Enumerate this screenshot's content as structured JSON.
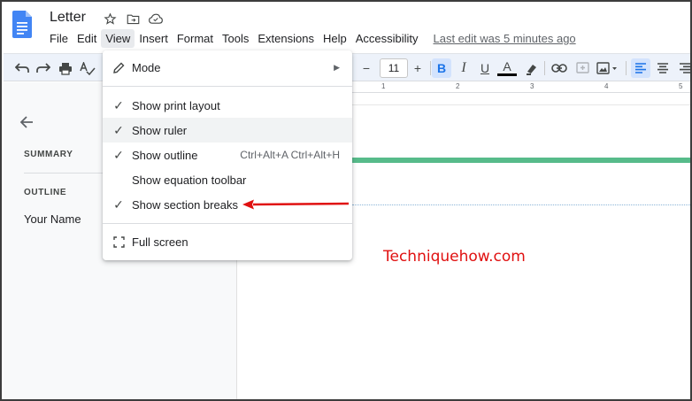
{
  "header": {
    "doc_title": "Letter",
    "menus": [
      "File",
      "Edit",
      "View",
      "Insert",
      "Format",
      "Tools",
      "Extensions",
      "Help",
      "Accessibility"
    ],
    "last_edit": "Last edit was 5 minutes ago"
  },
  "toolbar": {
    "font_size": "11",
    "decrease_label": "−",
    "increase_label": "+",
    "bold": "B",
    "italic": "I",
    "underline": "U",
    "text_color": "A"
  },
  "left_panel": {
    "summary": "SUMMARY",
    "outline": "OUTLINE",
    "heading": "Your Name"
  },
  "ruler": {
    "labels": [
      "1",
      "2",
      "3",
      "4",
      "5"
    ]
  },
  "view_menu": {
    "items": [
      {
        "label": "Mode",
        "icon": "pencil-icon",
        "checked": false
      },
      {
        "label": "Show print layout",
        "icon": "check-icon",
        "checked": true
      },
      {
        "label": "Show ruler",
        "icon": "check-icon",
        "checked": true
      },
      {
        "label": "Show outline",
        "icon": "check-icon",
        "checked": true,
        "shortcut": "Ctrl+Alt+A Ctrl+Alt+H"
      },
      {
        "label": "Show equation toolbar",
        "icon": "",
        "checked": false
      },
      {
        "label": "Show section breaks",
        "icon": "check-icon",
        "checked": true
      },
      {
        "label": "Full screen",
        "icon": "fullscreen-icon",
        "checked": false
      }
    ]
  },
  "watermark": "Techniquehow.com",
  "colors": {
    "accent": "#1a73e8",
    "green_bar": "#57bb8a",
    "arrow": "#e01010",
    "toolbar_bg": "#edf2fa"
  }
}
